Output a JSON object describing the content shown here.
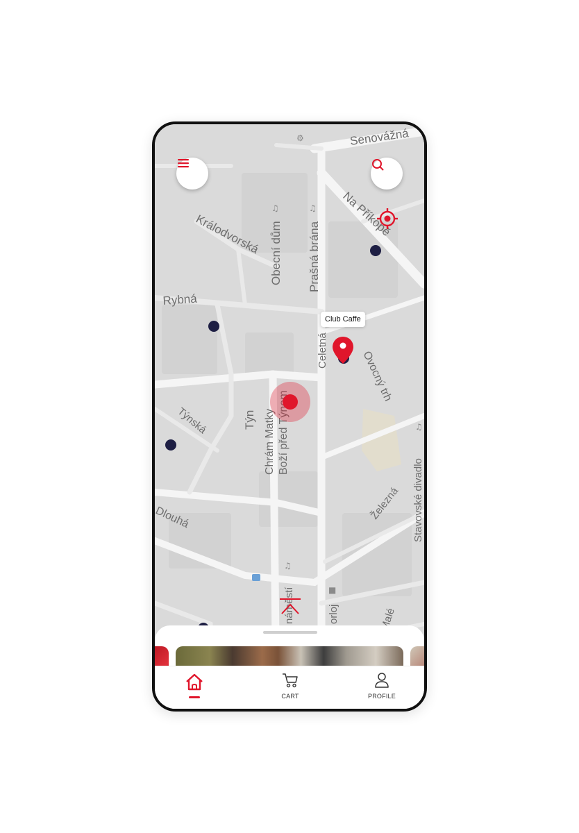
{
  "map": {
    "street_labels": [
      "Senovážná",
      "Na Příkopě",
      "Králodvorská",
      "Obecní dům",
      "Prašná brána",
      "Rybná",
      "Celetná",
      "Ovocný trh",
      "Chrám Matky",
      "Boží před Týnem",
      "Týn",
      "Týnská",
      "Dlouhá",
      "Železná",
      "Stavovské divadlo",
      "náměstí",
      "orloj",
      "Malé"
    ],
    "selected_place": "Club Caffe"
  },
  "bottom_nav": {
    "items": [
      {
        "label": "",
        "icon": "home-icon",
        "active": true
      },
      {
        "label": "CART",
        "icon": "cart-icon",
        "active": false
      },
      {
        "label": "PROFILE",
        "icon": "profile-icon",
        "active": false
      }
    ]
  },
  "colors": {
    "accent": "#e0162b",
    "marker_dark": "#1e1f44",
    "map_bg": "#dcdcdc"
  }
}
